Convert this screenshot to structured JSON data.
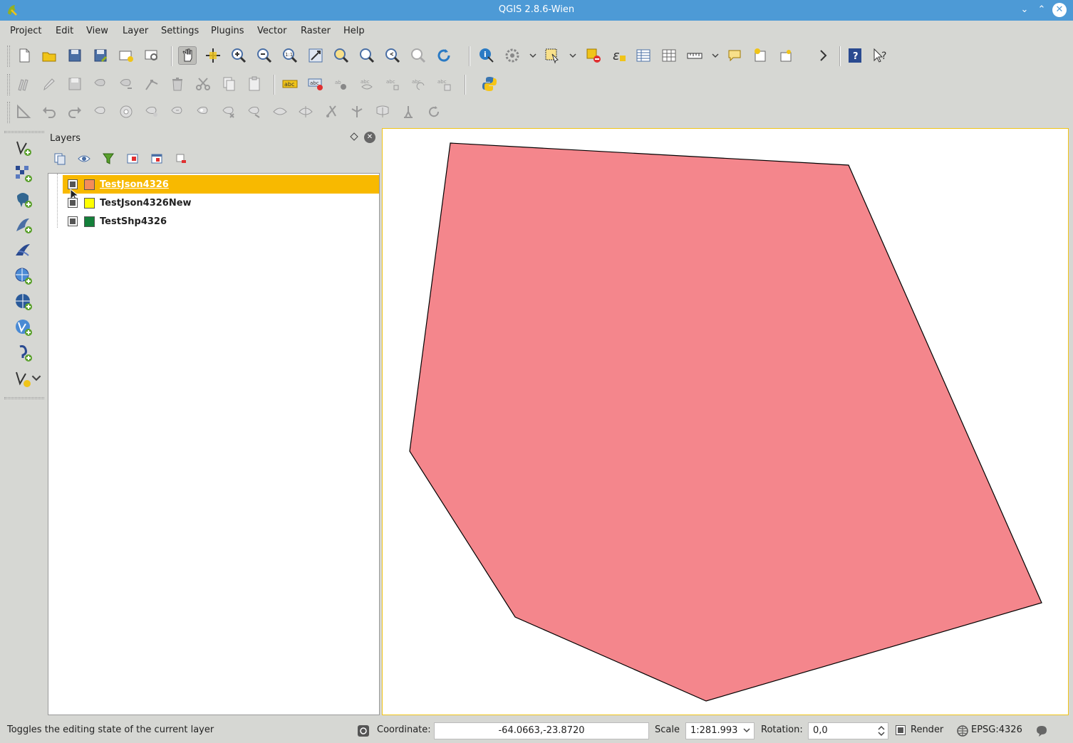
{
  "window": {
    "title": "QGIS 2.8.6-Wien",
    "minimize_glyph": "⌄",
    "maximize_glyph": "⌃",
    "close_glyph": "✕"
  },
  "menu": [
    "Project",
    "Edit",
    "View",
    "Layer",
    "Settings",
    "Plugins",
    "Vector",
    "Raster",
    "Help"
  ],
  "layers_panel": {
    "title": "Layers",
    "layers": [
      {
        "name": "TestJson4326",
        "color": "#f48c5a",
        "selected": true
      },
      {
        "name": "TestJson4326New",
        "color": "#ffff00",
        "selected": false
      },
      {
        "name": "TestShp4326",
        "color": "#14803a",
        "selected": false
      }
    ]
  },
  "map": {
    "polygon_fill": "#f4868c",
    "polygon_stroke": "#000000"
  },
  "status": {
    "message": "Toggles the editing state of the current layer",
    "coordinate_label": "Coordinate:",
    "coordinate_value": "-64.0663,-23.8720",
    "scale_label": "Scale",
    "scale_value": "1:281.993",
    "rotation_label": "Rotation:",
    "rotation_value": "0,0",
    "render_label": "Render",
    "crs": "EPSG:4326"
  },
  "icons": {
    "toolbar_more": "chevron-right-icon",
    "dropdown": "chevron-down-icon"
  }
}
